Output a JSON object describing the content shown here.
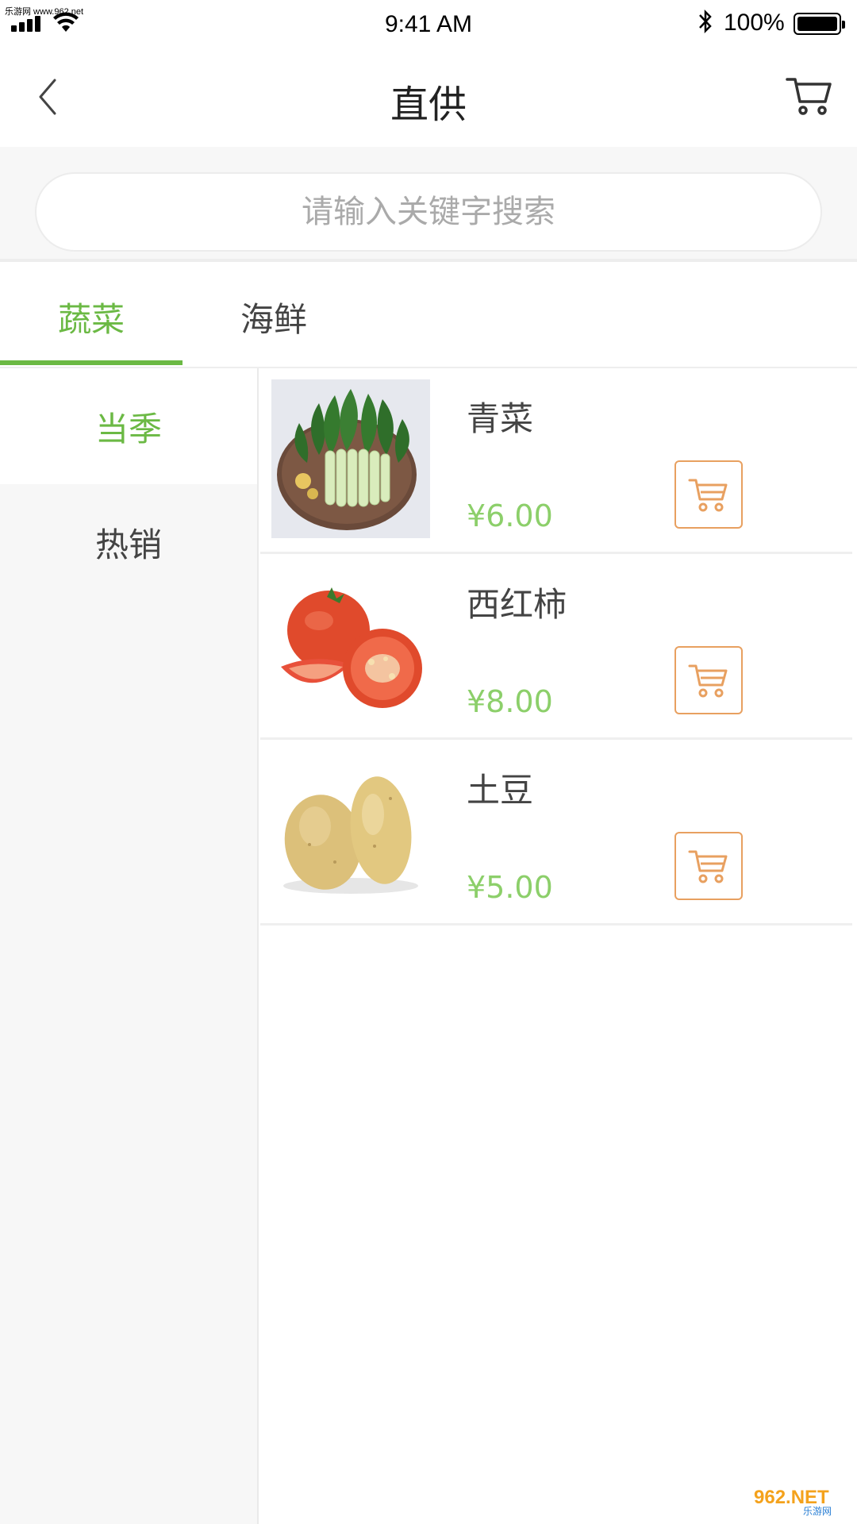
{
  "status_bar": {
    "watermark": "乐游网 www.962.net",
    "time": "9:41 AM",
    "battery": "100%"
  },
  "header": {
    "title": "直供"
  },
  "search": {
    "placeholder": "请输入关键字搜索"
  },
  "tabs": [
    {
      "label": "蔬菜",
      "active": true
    },
    {
      "label": "海鲜",
      "active": false
    }
  ],
  "sidebar": {
    "items": [
      {
        "label": "当季",
        "active": true
      },
      {
        "label": "热销",
        "active": false
      }
    ]
  },
  "products": [
    {
      "name": "青菜",
      "price": "¥6.00",
      "image": "bok-choy"
    },
    {
      "name": "西红柿",
      "price": "¥8.00",
      "image": "tomato"
    },
    {
      "name": "土豆",
      "price": "¥5.00",
      "image": "potato"
    }
  ],
  "watermark_logo": {
    "text": "962.NET",
    "subtext": "乐游网"
  },
  "colors": {
    "accent_green": "#6bb944",
    "price_green": "#8ccf6a",
    "cart_orange": "#e8a060"
  }
}
